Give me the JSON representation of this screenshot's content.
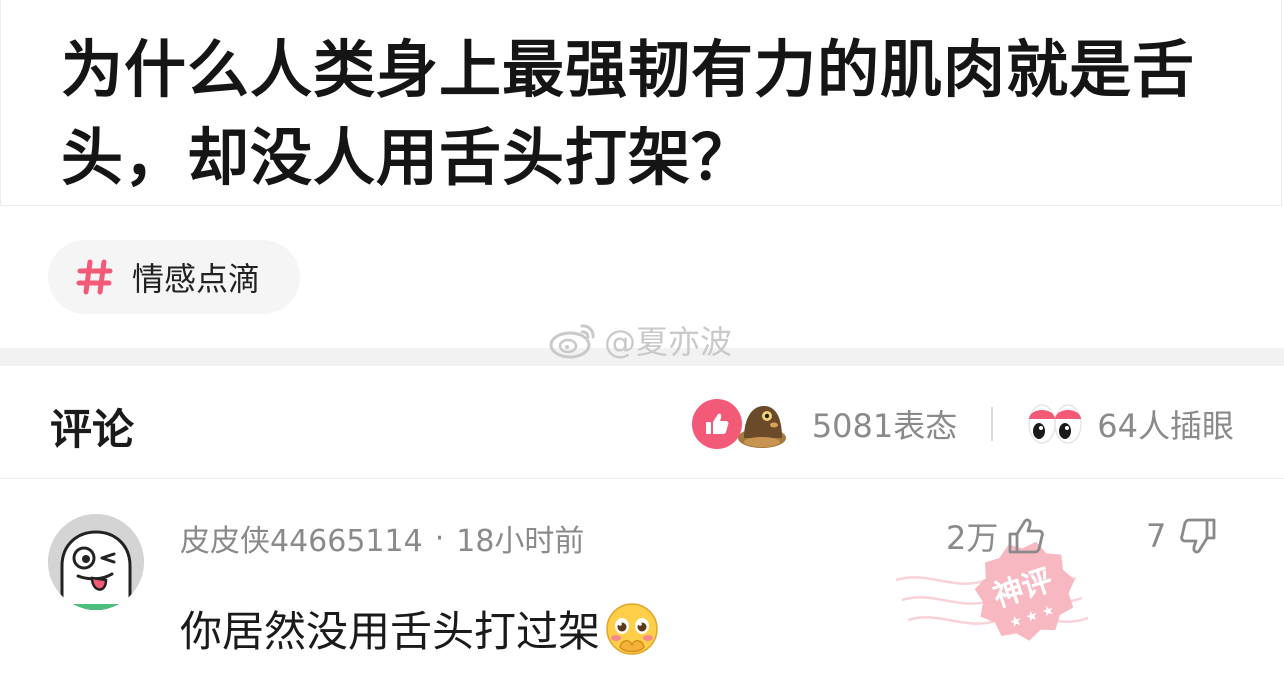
{
  "post": {
    "title": "为什么人类身上最强韧有力的肌肉就是舌头，却没人用舌头打架？"
  },
  "topic": {
    "label": "情感点滴",
    "icon": "hash-icon",
    "accent": "#f35a78"
  },
  "watermark": {
    "text": "@夏亦波",
    "icon": "weibo-icon"
  },
  "comments_header": {
    "title": "评论",
    "reactions_label": "5081表态",
    "glance_label": "64人插眼"
  },
  "comment": {
    "username": "皮皮侠44665114",
    "separator": "·",
    "time": "18小时前",
    "text": "你居然没用舌头打过架",
    "emoji": "pleading-face-emoji",
    "likes": "2万",
    "dislikes": "7",
    "badge": "神评"
  },
  "colors": {
    "accent_pink": "#f35a78",
    "secondary_text": "#8a8a8a",
    "stamp": "#f7b8c2"
  }
}
